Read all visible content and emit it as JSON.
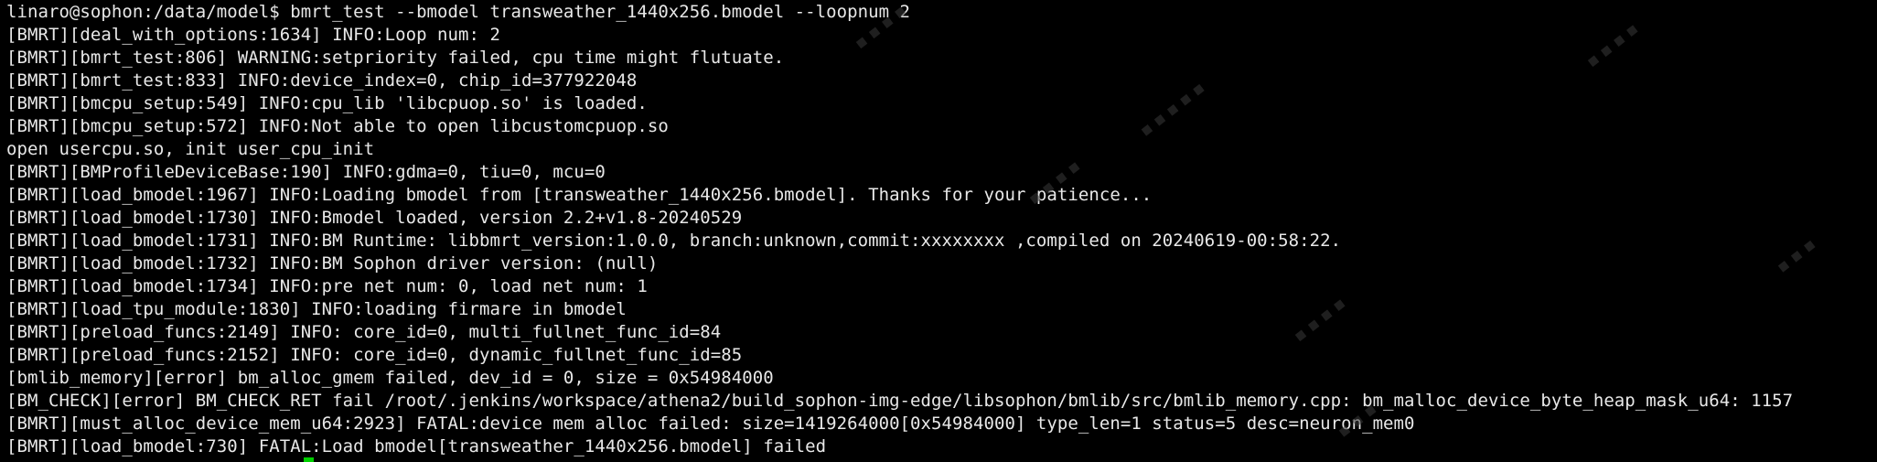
{
  "window": {
    "background_color": "#000000",
    "text_color": "#e8e8e8",
    "cursor_color": "#00d000"
  },
  "terminal": {
    "lines": [
      "linaro@sophon:/data/model$ bmrt_test --bmodel transweather_1440x256.bmodel --loopnum 2",
      "[BMRT][deal_with_options:1634] INFO:Loop num: 2",
      "[BMRT][bmrt_test:806] WARNING:setpriority failed, cpu time might flutuate.",
      "[BMRT][bmrt_test:833] INFO:device_index=0, chip_id=377922048",
      "[BMRT][bmcpu_setup:549] INFO:cpu_lib 'libcpuop.so' is loaded.",
      "[BMRT][bmcpu_setup:572] INFO:Not able to open libcustomcpuop.so",
      "open usercpu.so, init user_cpu_init",
      "[BMRT][BMProfileDeviceBase:190] INFO:gdma=0, tiu=0, mcu=0",
      "[BMRT][load_bmodel:1967] INFO:Loading bmodel from [transweather_1440x256.bmodel]. Thanks for your patience...",
      "[BMRT][load_bmodel:1730] INFO:Bmodel loaded, version 2.2+v1.8-20240529",
      "[BMRT][load_bmodel:1731] INFO:BM Runtime: libbmrt_version:1.0.0, branch:unknown,commit:xxxxxxxx ,compiled on 20240619-00:58:22.",
      "[BMRT][load_bmodel:1732] INFO:BM Sophon driver version: (null)",
      "[BMRT][load_bmodel:1734] INFO:pre net num: 0, load net num: 1",
      "[BMRT][load_tpu_module:1830] INFO:loading firmare in bmodel",
      "[BMRT][preload_funcs:2149] INFO: core_id=0, multi_fullnet_func_id=84",
      "[BMRT][preload_funcs:2152] INFO: core_id=0, dynamic_fullnet_func_id=85",
      "[bmlib_memory][error] bm_alloc_gmem failed, dev_id = 0, size = 0x54984000",
      "[BM_CHECK][error] BM_CHECK_RET fail /root/.jenkins/workspace/athena2/build_sophon-img-edge/libsophon/bmlib/src/bmlib_memory.cpp: bm_malloc_device_byte_heap_mask_u64: 1157",
      "[BMRT][must_alloc_device_mem_u64:2923] FATAL:device mem alloc failed: size=1419264000[0x54984000] type_len=1 status=5 desc=neuron_mem0",
      "[BMRT][load_bmodel:730] FATAL:Load bmodel[transweather_1440x256.bmodel] failed"
    ]
  }
}
